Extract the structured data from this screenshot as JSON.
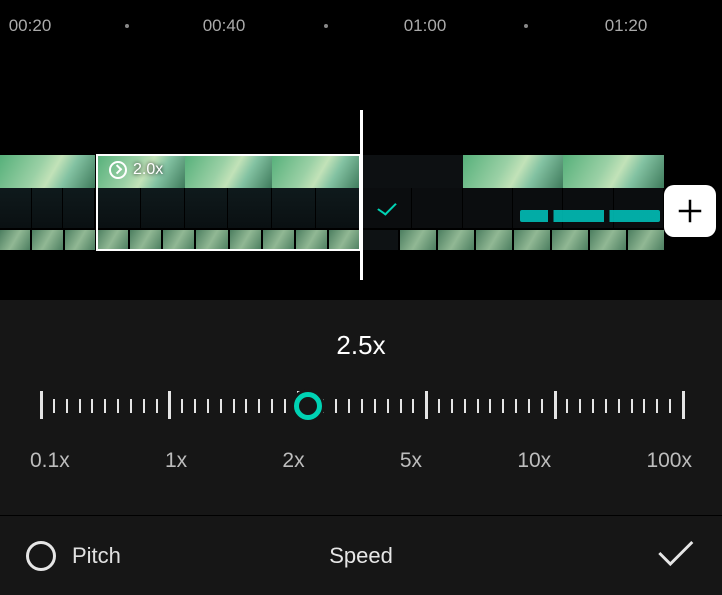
{
  "ruler": {
    "labels": [
      {
        "text": "00:20",
        "pos": 30
      },
      {
        "text": "00:40",
        "pos": 224
      },
      {
        "text": "01:00",
        "pos": 425
      },
      {
        "text": "01:20",
        "pos": 626
      }
    ],
    "dots": [
      127,
      326,
      526
    ]
  },
  "timeline": {
    "selected_clip_speed": "2.0x",
    "add_label": "add"
  },
  "speed": {
    "current": "2.5x",
    "ticks_between": 9,
    "labels": [
      "0.1x",
      "1x",
      "2x",
      "5x",
      "10x",
      "100x"
    ],
    "knob_percent": 42
  },
  "footer": {
    "pitch_label": "Pitch",
    "title": "Speed"
  }
}
